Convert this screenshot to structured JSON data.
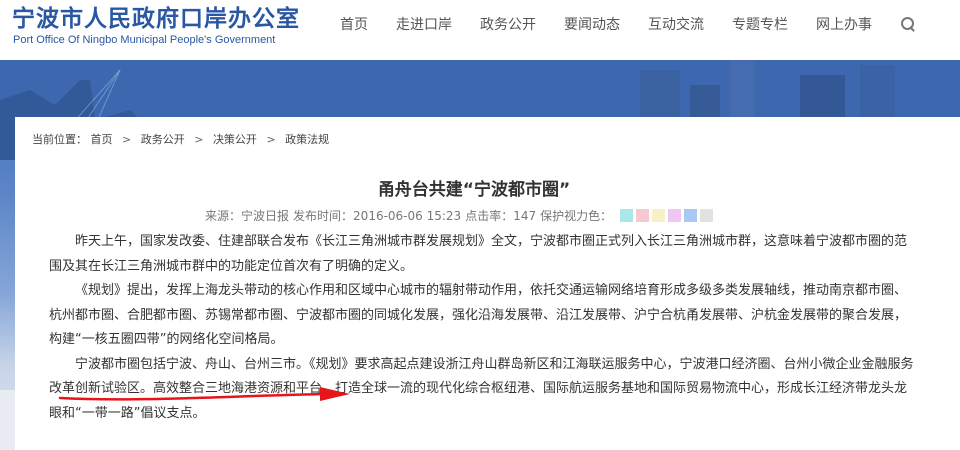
{
  "header": {
    "logo_cn": "宁波市人民政府口岸办公室",
    "logo_en": "Port Office Of Ningbo Municipal People's Government",
    "nav": [
      {
        "label": "首页"
      },
      {
        "label": "走进口岸"
      },
      {
        "label": "政务公开"
      },
      {
        "label": "要闻动态"
      },
      {
        "label": "互动交流"
      },
      {
        "label": "专题专栏"
      },
      {
        "label": "网上办事"
      }
    ],
    "search_icon": "search-icon"
  },
  "breadcrumb": {
    "prefix": "当前位置：",
    "items": [
      "首页",
      "政务公开",
      "决策公开",
      "政策法规"
    ],
    "sep": ">"
  },
  "article": {
    "title": "甬舟台共建“宁波都市圈”",
    "source_label": "来源：",
    "source": "宁波日报",
    "time_label": "发布时间：",
    "time": "2016-06-06 15:23",
    "clicks_label": "点击率：",
    "clicks": "147",
    "eye_label": "保护视力色：",
    "eye_colors": [
      "#a8e8e8",
      "#f6c9d0",
      "#f7f0c8",
      "#f1c6f1",
      "#a9c9f5",
      "#e2e2e2"
    ],
    "paragraphs": [
      "昨天上午，国家发改委、住建部联合发布《长江三角洲城市群发展规划》全文，宁波都市圈正式列入长江三角洲城市群，这意味着宁波都市圈的范围及其在长江三角洲城市群中的功能定位首次有了明确的定义。",
      "《规划》提出，发挥上海龙头带动的核心作用和区域中心城市的辐射带动作用，依托交通运输网络培育形成多级多类发展轴线，推动南京都市圈、杭州都市圈、合肥都市圈、苏锡常都市圈、宁波都市圈的同城化发展，强化沿海发展带、沿江发展带、沪宁合杭甬发展带、沪杭金发展带的聚合发展，构建“一核五圈四带”的网络化空间格局。",
      "宁波都市圈包括宁波、舟山、台州三市。《规划》要求高起点建设浙江舟山群岛新区和江海联运服务中心，宁波港口经济圈、台州小微企业金融服务改革创新试验区。高效整合三地海港资源和平台，打造全球一流的现代化综合枢纽港、国际航运服务基地和国际贸易物流中心，形成长江经济带龙头龙眼和“一带一路”倡议支点。"
    ]
  },
  "colors": {
    "brand": "#2a57a4",
    "annotation": "#e8141c"
  }
}
